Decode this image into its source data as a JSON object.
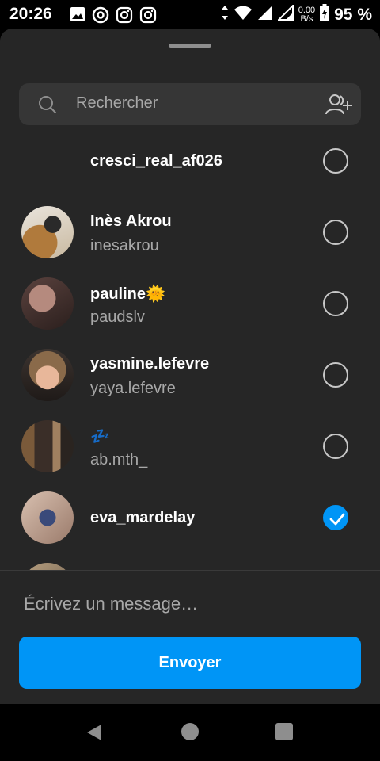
{
  "status_bar": {
    "time": "20:26",
    "net_speed_value": "0.00",
    "net_speed_unit": "B/s",
    "battery": "95 %"
  },
  "search": {
    "placeholder": "Rechercher"
  },
  "contacts": [
    {
      "name": "cresci_real_af026",
      "username": "",
      "selected": false
    },
    {
      "name": "Inès Akrou",
      "username": "inesakrou",
      "selected": false
    },
    {
      "name": "pauline🌞",
      "username": "paudslv",
      "selected": false
    },
    {
      "name": "yasmine.lefevre",
      "username": "yaya.lefevre",
      "selected": false
    },
    {
      "name": "💤",
      "username": "ab.mth_",
      "selected": false
    },
    {
      "name": "eva_mardelay",
      "username": "",
      "selected": true
    }
  ],
  "message": {
    "placeholder": "Écrivez un message…"
  },
  "send_button": {
    "label": "Envoyer"
  },
  "colors": {
    "accent": "#0095f6",
    "sheet_bg": "#262626",
    "search_bg": "#363636"
  }
}
